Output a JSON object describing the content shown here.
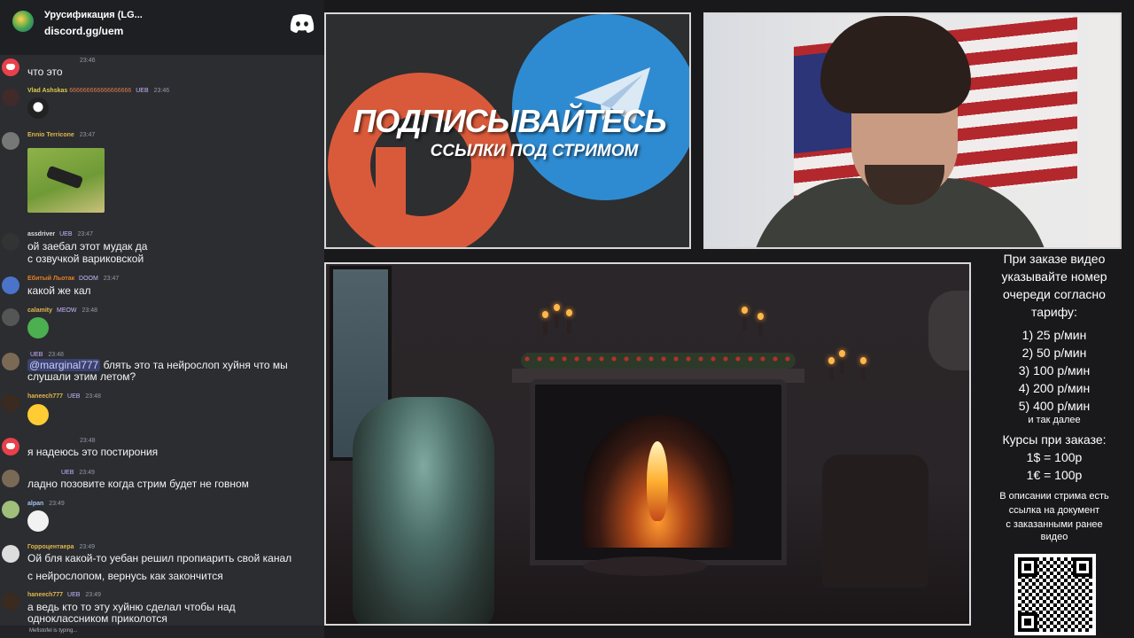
{
  "header": {
    "server_title": "Урусификация (LG...",
    "server_link": "discord.gg/uem"
  },
  "messages": [
    {
      "name": "",
      "tag": "",
      "time": "23:46",
      "text": "что это",
      "avatar": "discord-avatar"
    },
    {
      "name": "Vlad Ashskas",
      "name_suffix": "666666666666666666",
      "tag": "UEB",
      "time": "23:46",
      "emoji": "penguin-emoji",
      "avatar": "user-avatar"
    },
    {
      "name": "Ennio Terricone",
      "tag": "",
      "time": "23:47",
      "image": "meme-image",
      "avatar": "user-avatar"
    },
    {
      "name": "assdriver",
      "tag": "UEB",
      "time": "23:47",
      "text": "ой заебал этот мудак да",
      "text2": "с озвучкой вариковской",
      "avatar": "user-avatar"
    },
    {
      "name": "Ебитый Льотак",
      "tag": "DOOM",
      "time": "23:47",
      "text": "какой же кал",
      "avatar": "user-avatar"
    },
    {
      "name": "calamity",
      "tag": "MEOW",
      "time": "23:48",
      "emoji": "pepe-emoji",
      "avatar": "user-avatar"
    },
    {
      "name": "",
      "tag": "UEB",
      "time": "23:48",
      "mention": "@marginal777",
      "text": "блять это та нейрослоп хуйня что мы",
      "text2": "слушали этим летом?",
      "avatar": "user-avatar"
    },
    {
      "name": "haneech777",
      "tag": "UEB",
      "time": "23:48",
      "emoji": "laughing-emoji",
      "avatar": "user-avatar"
    },
    {
      "name": "",
      "tag": "",
      "time": "23:48",
      "text": "я надеюсь это постирония",
      "avatar": "discord-avatar"
    },
    {
      "name": "",
      "tag": "UEB",
      "time": "23:49",
      "text": "ладно позовите когда стрим будет не говном",
      "avatar": "user-avatar"
    },
    {
      "name": "alpan",
      "tag": "",
      "time": "23:49",
      "emoji": "trollface-emoji",
      "avatar": "user-avatar"
    },
    {
      "name": "Горроцентаера",
      "tag": "",
      "time": "23:49",
      "text": "Ой бля какой-то уебан решил пропиарить свой канал",
      "text2": "с нейрослопом, вернусь как закончится",
      "avatar": "user-avatar"
    },
    {
      "name": "haneech777",
      "tag": "UEB",
      "time": "23:49",
      "text": "а ведь кто то эту хуйню сделал чтобы над",
      "text2": "одноклассником приколотся",
      "avatar": "user-avatar"
    }
  ],
  "footer": {
    "typing": "Mefistofel is typing..."
  },
  "banner": {
    "title": "ПОДПИСЫВАЙТЕСЬ",
    "subtitle": "ССЫЛКИ ПОД СТРИМОМ"
  },
  "side": {
    "intro": [
      "При заказе видео",
      "указывайте номер",
      "очереди согласно",
      "тарифу:"
    ],
    "tariffs": [
      "1) 25 р/мин",
      "2) 50 р/мин",
      "3) 100 р/мин",
      "4) 200 р/мин",
      "5) 400 р/мин"
    ],
    "etc": "и так далее",
    "rates_title": "Курсы при заказе:",
    "rates": [
      "1$ = 100р",
      "1€ = 100р"
    ],
    "desc": [
      "В описании стрима есть",
      "ссылка на документ",
      "с заказанными ранее",
      "видео"
    ]
  },
  "colors": {
    "chat_bg": "#2b2d31",
    "header_bg": "#1e1f22",
    "discord_red": "#e8414b",
    "telegram_blue": "#2f8bd1",
    "patreon_orange": "#d95a3a"
  }
}
